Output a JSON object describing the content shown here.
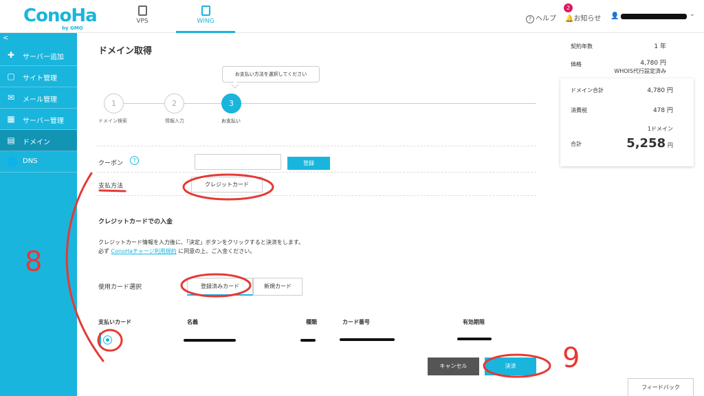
{
  "header": {
    "logo": "ConoHa",
    "logo_sub": "by GMO",
    "tabs": [
      {
        "label": "VPS"
      },
      {
        "label": "WING"
      }
    ],
    "help": "ヘルプ",
    "notifications": "お知らせ",
    "notification_count": "2"
  },
  "sidebar": {
    "collapse": "<",
    "items": [
      {
        "label": "サーバー追加",
        "icon": "plus-icon"
      },
      {
        "label": "サイト管理",
        "icon": "site-icon"
      },
      {
        "label": "メール管理",
        "icon": "mail-icon"
      },
      {
        "label": "サーバー管理",
        "icon": "server-icon"
      },
      {
        "label": "ドメイン",
        "icon": "domain-icon"
      },
      {
        "label": "DNS",
        "icon": "globe-icon"
      }
    ]
  },
  "main": {
    "title": "ドメイン取得",
    "tooltip": "お支払い方法を選択してください",
    "steps": [
      {
        "num": "1",
        "label": "ドメイン検索"
      },
      {
        "num": "2",
        "label": "情報入力"
      },
      {
        "num": "3",
        "label": "お支払い"
      }
    ],
    "coupon_label": "クーポン",
    "coupon_help": "?",
    "coupon_register": "登録",
    "payment_method_label": "支払方法",
    "payment_method_value": "クレジットカード",
    "section_title": "クレジットカードでの入金",
    "desc_line1": "クレジットカード情報を入力後に、「決定」ボタンをクリックすると決済をします。",
    "desc_line2_pre": "必ず",
    "desc_line2_link": "ConoHaチャージ利用規約",
    "desc_line2_post": "に同意の上、ご入金ください。",
    "card_select_label": "使用カード選択",
    "card_tabs": [
      "登録済みカード",
      "新規カード"
    ],
    "columns": [
      "支払いカード",
      "名義",
      "種類",
      "カード番号",
      "有効期限"
    ],
    "cancel": "キャンセル",
    "pay": "決済",
    "feedback": "フィードバック"
  },
  "summary": {
    "years_label": "契約年数",
    "years_value": "1 年",
    "price_label": "価格",
    "price_value": "4,780 円",
    "whois": "WHOIS代行設定済み",
    "domain_total_label": "ドメイン合計",
    "domain_total_value": "4,780 円",
    "tax_label": "消費税",
    "tax_value": "478 円",
    "count": "1ドメイン",
    "total_label": "合計",
    "total_value": "5,258",
    "total_unit": "円"
  },
  "annotations": {
    "step8": "8",
    "step9": "9"
  },
  "colors": {
    "accent": "#19b5dc",
    "annotation": "#e53935"
  }
}
